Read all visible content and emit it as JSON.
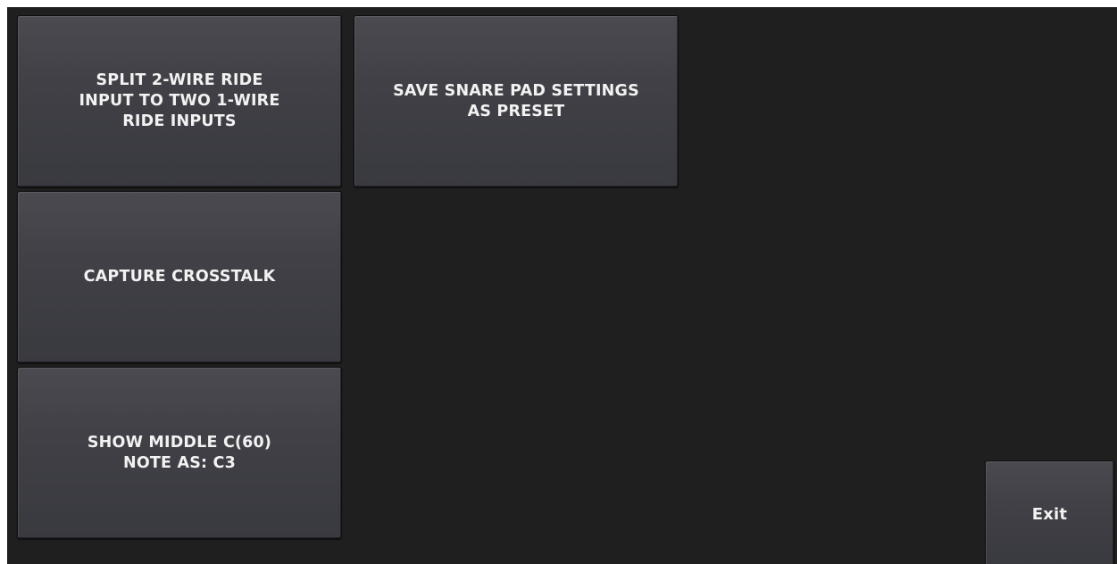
{
  "buttons": {
    "split_ride": "SPLIT 2-WIRE RIDE\nINPUT TO TWO 1-WIRE\nRIDE INPUTS",
    "save_preset": "SAVE SNARE PAD SETTINGS\nAS PRESET",
    "capture_crosstalk": "CAPTURE CROSSTALK",
    "middle_c": "SHOW MIDDLE C(60)\nNOTE AS: C3",
    "exit": "Exit"
  }
}
